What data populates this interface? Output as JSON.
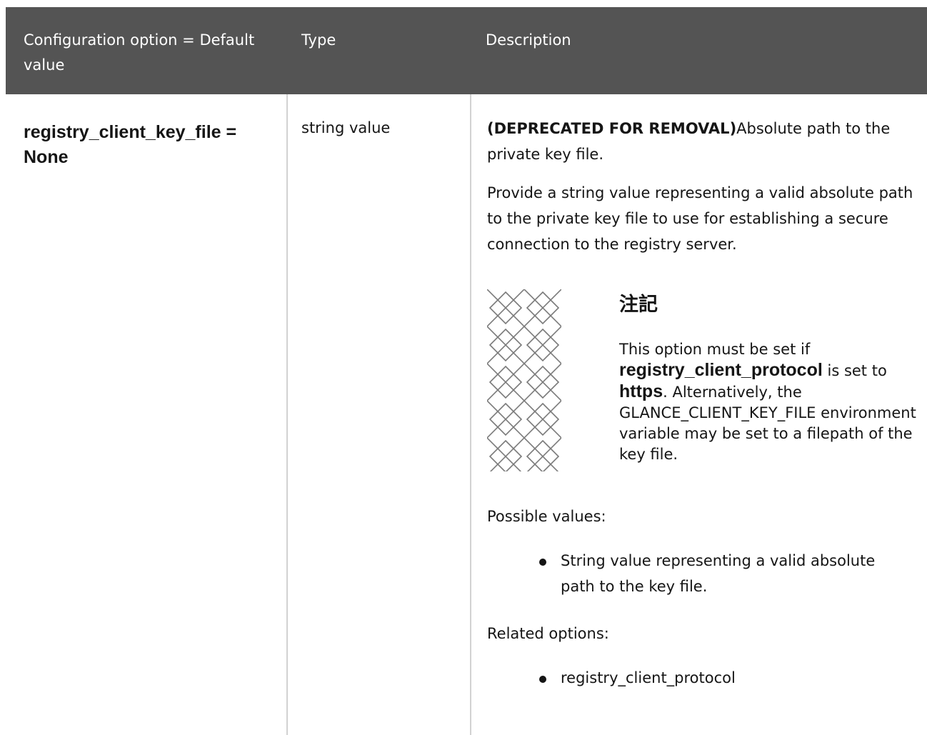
{
  "table": {
    "headers": {
      "option": "Configuration option = Default value",
      "type": "Type",
      "description": "Description"
    },
    "row": {
      "option": "registry_client_key_file = None",
      "type": "string value",
      "description": {
        "deprecated_tag": "(DEPRECATED FOR REMOVAL)",
        "intro": "Absolute path to the private key file.",
        "provide": "Provide a string value representing a valid absolute path to the private key file to use for establishing a secure connection to the registry server.",
        "note": {
          "title": "注記",
          "text_1": "This option must be set if ",
          "bold_1": "registry_client_protocol",
          "text_2": " is set to ",
          "bold_2": "https",
          "text_3": ". Alternatively, the GLANCE_CLIENT_KEY_FILE environment variable may be set to a filepath of the key file."
        },
        "possible_label": "Possible values:",
        "possible_items": [
          "String value representing a valid absolute path to the key file."
        ],
        "related_label": "Related options:",
        "related_items": [
          "registry_client_protocol"
        ]
      }
    }
  },
  "colors": {
    "header_bg": "#545454",
    "header_text": "#ffffff",
    "body_text": "#151515",
    "rule": "#d2d2d2"
  },
  "icons": {
    "note": "note-pattern-icon"
  }
}
